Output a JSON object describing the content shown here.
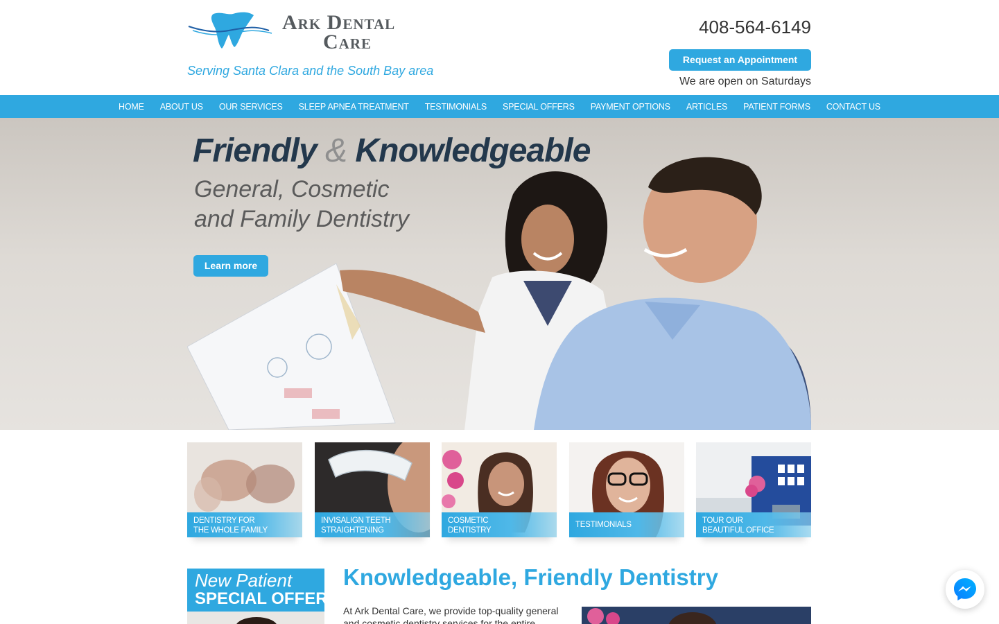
{
  "header": {
    "logo_line1": "Ark Dental",
    "logo_line2": "Care",
    "logo_icon": "tooth-wave-icon",
    "tagline": "Serving Santa Clara and the South Bay area",
    "phone": "408-564-6149",
    "appointment_button": "Request an Appointment",
    "open_note": "We are open on Saturdays"
  },
  "nav": {
    "items": [
      "HOME",
      "ABOUT US",
      "OUR SERVICES",
      "SLEEP APNEA TREATMENT",
      "TESTIMONIALS",
      "SPECIAL OFFERS",
      "PAYMENT OPTIONS",
      "ARTICLES",
      "PATIENT FORMS",
      "CONTACT US"
    ]
  },
  "hero": {
    "title_part1": "Friendly",
    "title_amp": "&",
    "title_part2": "Knowledgeable",
    "subtitle_line1": "General, Cosmetic",
    "subtitle_line2": "and Family Dentistry",
    "button": "Learn more"
  },
  "tiles": [
    {
      "line1": "Dentistry for",
      "line2": "the whole family"
    },
    {
      "line1": "Invisalign teeth",
      "line2": "straightening"
    },
    {
      "line1": "Cosmetic",
      "line2": "Dentistry"
    },
    {
      "line1": "Testimonials",
      "line2": ""
    },
    {
      "line1": "Tour our",
      "line2": "beautiful office"
    }
  ],
  "offer": {
    "line1": "New Patient",
    "line2": "SPECIAL OFFER"
  },
  "main": {
    "heading": "Knowledgeable, Friendly Dentistry",
    "paragraph": "At Ark Dental Care, we provide top-quality general and cosmetic dentistry services for the entire"
  },
  "colors": {
    "brand_blue": "#2fa8e0",
    "dark_navy": "#23384c",
    "text_gray": "#333333"
  },
  "messenger": {
    "icon": "messenger-icon"
  }
}
